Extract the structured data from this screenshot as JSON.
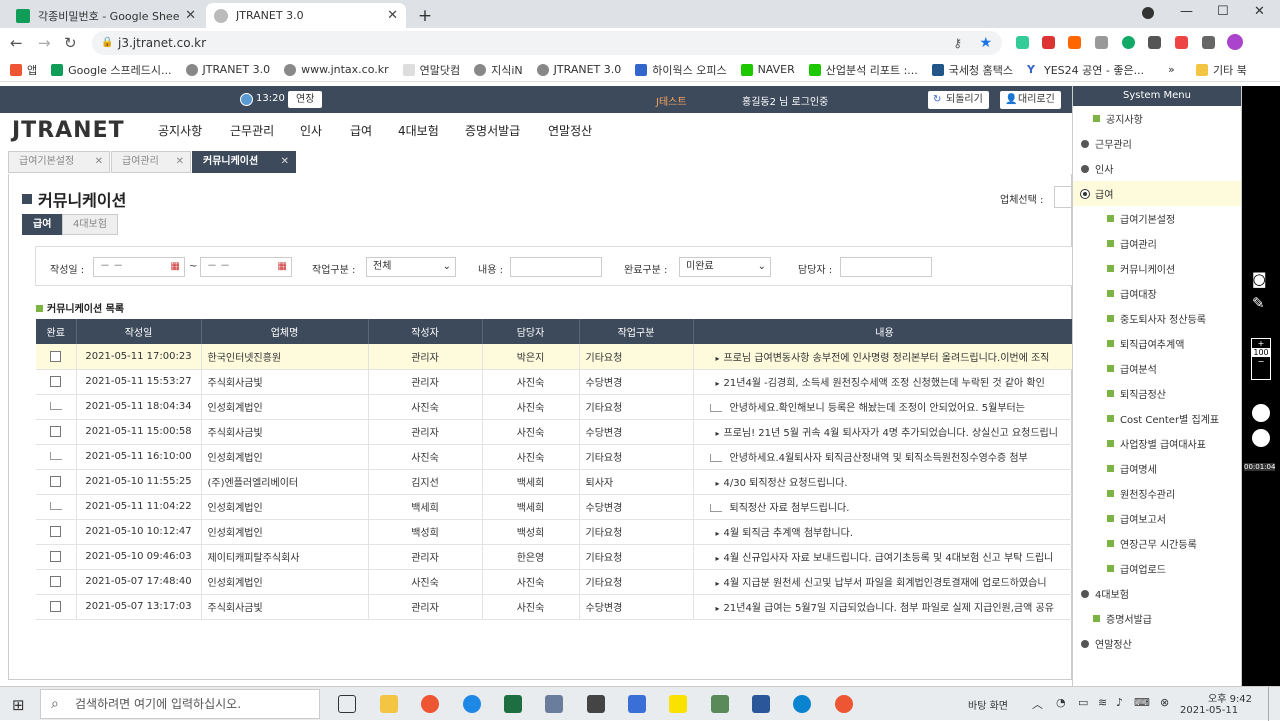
{
  "browser": {
    "tabs": [
      {
        "title": "각종비밀번호 - Google Sheets",
        "color": "#0f9d58"
      },
      {
        "title": "JTRANET 3.0",
        "color": "#888888"
      }
    ],
    "url": "j3.jtranet.co.kr",
    "bookmarks": [
      "앱",
      "Google 스프레드시...",
      "JTRANET 3.0",
      "www.jntax.co.kr",
      "연말닷컴",
      "지식iN",
      "JTRANET 3.0",
      "하이웍스 오피스",
      "NAVER",
      "산업분석 리포트 :...",
      "국세청 홈택스",
      "YES24 공연 - 좋은..."
    ],
    "bookmarks_more": "»",
    "bookmarks_other": "기타 북"
  },
  "topbar": {
    "time": "13:20",
    "extend_label": "연장",
    "test_label": "J테스트",
    "user_text": "홍길동2 님 로그인중",
    "refresh_label": "되돌리기",
    "proxy_label": "대리로긴"
  },
  "logo": "JTRANET",
  "main_menu": [
    "공지사항",
    "근무관리",
    "인사",
    "급여",
    "4대보험",
    "증명서발급",
    "연말정산"
  ],
  "page_tabs": [
    "급여기본설정",
    "급여관리",
    "커뮤니케이션"
  ],
  "page_title": "커뮤니케이션",
  "company_select_label": "업체선택 :",
  "sub_tabs": [
    "급여",
    "4대보험"
  ],
  "filter": {
    "date_label": "작성일 :",
    "date_placeholder": "－ －",
    "tilde": "~",
    "type_label": "작업구분 :",
    "type_value": "전체",
    "content_label": "내용 :",
    "done_label": "완료구분 :",
    "done_value": "미완료",
    "manager_label": "담당자 :"
  },
  "list_title": "커뮤니케이션 목록",
  "columns": [
    "완료",
    "작성일",
    "업체명",
    "작성자",
    "담당자",
    "작업구분",
    "내용"
  ],
  "rows": [
    {
      "reply": false,
      "date": "2021-05-11 17:00:23",
      "company": "한국인터넷진흥원",
      "writer": "관리자",
      "manager": "박은지",
      "type": "기타요청",
      "content": "프로님 급여변동사항 송부전에 인사명령 정리본부터 올려드립니다.이번에 조직"
    },
    {
      "reply": false,
      "date": "2021-05-11 15:53:27",
      "company": "주식회사금빛",
      "writer": "관리자",
      "manager": "사진숙",
      "type": "수당변경",
      "content": "21년4월 -김경희, 소득세 원천징수세액 조정 신청했는데 누락된 것 같아 확인"
    },
    {
      "reply": true,
      "date": "2021-05-11 18:04:34",
      "company": "인성회계법인",
      "writer": "사진숙",
      "manager": "사진숙",
      "type": "기타요청",
      "content": "안녕하세요.확인해보니 등록은 해놨는데 조정이 안되었어요. 5월부터는"
    },
    {
      "reply": false,
      "date": "2021-05-11 15:00:58",
      "company": "주식회사금빛",
      "writer": "관리자",
      "manager": "사진숙",
      "type": "수당변경",
      "content": "프로님! 21년 5월 귀속 4월 퇴사자가 4명 추가되었습니다. 상실신고 요청드립니"
    },
    {
      "reply": true,
      "date": "2021-05-11 16:10:00",
      "company": "인성회계법인",
      "writer": "사진숙",
      "manager": "사진숙",
      "type": "기타요청",
      "content": "안녕하세요.4월퇴사자 퇴직금산정내역 및 퇴직소득원천징수영수증 첨부"
    },
    {
      "reply": false,
      "date": "2021-05-10 11:55:25",
      "company": "(주)엔플러엘리베이터",
      "writer": "김지선",
      "manager": "백세희",
      "type": "퇴사자",
      "content": "4/30 퇴직정산 요청드립니다."
    },
    {
      "reply": true,
      "date": "2021-05-11 11:04:22",
      "company": "인성회계법인",
      "writer": "백세희",
      "manager": "백세희",
      "type": "수당변경",
      "content": "퇴직정산 자료 첨부드립니다."
    },
    {
      "reply": false,
      "date": "2021-05-10 10:12:47",
      "company": "인성회계법인",
      "writer": "백성희",
      "manager": "백성희",
      "type": "기타요청",
      "content": "4월 퇴직금 추계액 첨부합니다."
    },
    {
      "reply": false,
      "date": "2021-05-10 09:46:03",
      "company": "제이티캐피탈주식회사",
      "writer": "관리자",
      "manager": "한은영",
      "type": "기타요청",
      "content": "4월 신규입사자 자료 보내드립니다. 급여기초등록 및 4대보험 신고 부탁 드립니"
    },
    {
      "reply": false,
      "date": "2021-05-07 17:48:40",
      "company": "인성회계법인",
      "writer": "사진숙",
      "manager": "사진숙",
      "type": "기타요청",
      "content": "4월 지급분 원천세 신고및 납부서 파일을 회계법인경토결재에 업로드하였습니"
    },
    {
      "reply": false,
      "date": "2021-05-07 13:17:03",
      "company": "주식회사금빛",
      "writer": "관리자",
      "manager": "사진숙",
      "type": "수당변경",
      "content": "21년4월 급여는 5월7일 지급되었습니다. 첨부 파일로 실제 지급인원,금액 공유"
    }
  ],
  "system_menu": {
    "title": "System Menu",
    "items": [
      {
        "label": "공지사항",
        "kind": "leaf",
        "hl": false
      },
      {
        "label": "근무관리",
        "kind": "group",
        "hl": false
      },
      {
        "label": "인사",
        "kind": "group",
        "hl": false
      },
      {
        "label": "급여",
        "kind": "open",
        "hl": true
      },
      {
        "label": "급여기본설정",
        "kind": "sub",
        "hl": false
      },
      {
        "label": "급여관리",
        "kind": "sub",
        "hl": false
      },
      {
        "label": "커뮤니케이션",
        "kind": "sub",
        "hl": false
      },
      {
        "label": "급여대장",
        "kind": "sub",
        "hl": false
      },
      {
        "label": "중도퇴사자 정산등록",
        "kind": "sub",
        "hl": false
      },
      {
        "label": "퇴직급여추계액",
        "kind": "sub",
        "hl": false
      },
      {
        "label": "급여분석",
        "kind": "sub",
        "hl": false
      },
      {
        "label": "퇴직금정산",
        "kind": "sub",
        "hl": false
      },
      {
        "label": "Cost Center별 집계표",
        "kind": "sub",
        "hl": false
      },
      {
        "label": "사업장별 급여대사표",
        "kind": "sub",
        "hl": false
      },
      {
        "label": "급여명세",
        "kind": "sub",
        "hl": false
      },
      {
        "label": "원천징수관리",
        "kind": "sub",
        "hl": false
      },
      {
        "label": "급여보고서",
        "kind": "sub",
        "hl": false
      },
      {
        "label": "연장근무 시간등록",
        "kind": "sub",
        "hl": false
      },
      {
        "label": "급여업로드",
        "kind": "sub",
        "hl": false
      },
      {
        "label": "4대보험",
        "kind": "group",
        "hl": false
      },
      {
        "label": "증명서발급",
        "kind": "leaf",
        "hl": false
      },
      {
        "label": "연말정산",
        "kind": "group",
        "hl": false
      }
    ]
  },
  "side_toolbar": {
    "zoom": "100",
    "plus": "+",
    "minus": "−",
    "timer": "00:01:04"
  },
  "taskbar": {
    "search_placeholder": "검색하려면 여기에 입력하십시오.",
    "desktop_label": "바탕 화면",
    "time": "오후 9:42",
    "date": "2021-05-11"
  }
}
